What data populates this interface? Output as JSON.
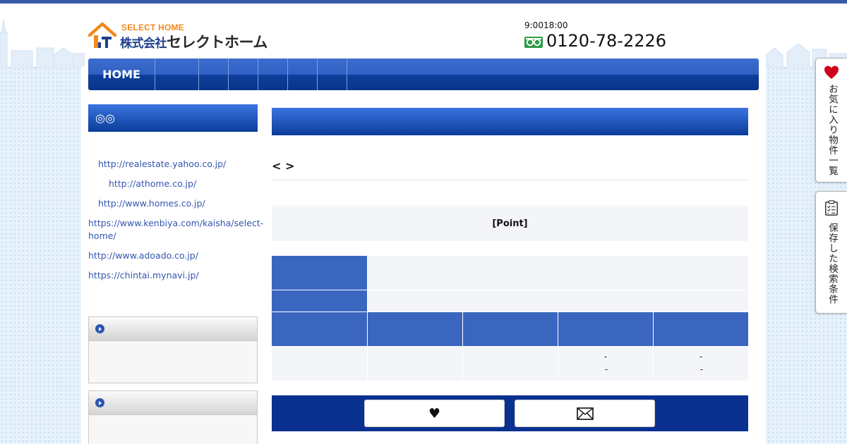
{
  "brand": {
    "sub": "SELECT HOME",
    "name_prefix": "株式会社",
    "name_main": "セレクトホーム"
  },
  "contact": {
    "hours": "9:0018:00",
    "phone": "0120-78-2226",
    "freedial_icon": "freedial-icon"
  },
  "nav": {
    "home_label": "HOME",
    "items": [
      "",
      "",
      "",
      "",
      "",
      ""
    ]
  },
  "sidebar": {
    "heading": "◎◎",
    "links": [
      "http://realestate.yahoo.co.jp/",
      "http://athome.co.jp/",
      "http://www.homes.co.jp/",
      "https://www.kenbiya.com/kaisha/select-home/",
      "http://www.adoado.co.jp/",
      "https://chintai.mynavi.jp/"
    ],
    "boxes": [
      {
        "icon": "play-circle-icon",
        "title": ""
      },
      {
        "icon": "play-circle-icon",
        "title": ""
      }
    ]
  },
  "main": {
    "pager": "< >",
    "point_label": "[Point]",
    "table": {
      "dash_a": "-",
      "dash_b": "-",
      "dash_c": "-",
      "dash_d": "-"
    },
    "actions": [
      {
        "icon": "heart-icon",
        "glyph": "♥"
      },
      {
        "icon": "mail-icon",
        "glyph": "✉"
      }
    ]
  },
  "float_tabs": [
    {
      "icon": "heart-icon",
      "label": "お気に入り物件一覧"
    },
    {
      "icon": "clipboard-icon",
      "label": "保存した検索条件"
    }
  ],
  "colors": {
    "top_bar": "#3a5aa8",
    "nav_blue": "#0a348a",
    "accent_blue": "#3a66bf",
    "logo_orange": "#f08a1c",
    "heart_red": "#d0021b",
    "freedial_green": "#2e9c47"
  }
}
